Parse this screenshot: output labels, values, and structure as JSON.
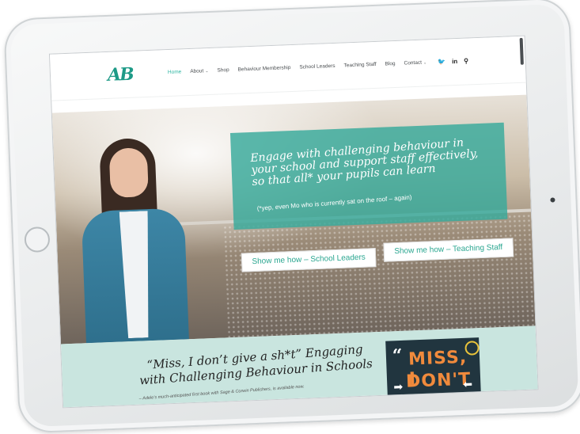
{
  "header": {
    "logo_text": "AB",
    "nav_items": [
      {
        "label": "Home",
        "active": true
      },
      {
        "label": "About",
        "has_dropdown": true
      },
      {
        "label": "Shop"
      },
      {
        "label": "Behaviour Membership"
      },
      {
        "label": "School Leaders"
      },
      {
        "label": "Teaching Staff"
      },
      {
        "label": "Blog"
      },
      {
        "label": "Contact",
        "has_dropdown": true
      }
    ],
    "social": {
      "twitter_icon": "twitter-icon",
      "linkedin_label": "in",
      "search_icon": "search-icon"
    }
  },
  "hero": {
    "headline": "Engage with challenging behaviour in your school and support staff effectively, so that all* your pupils can learn",
    "subline": "(*yep, even Mo who is currently sat on the roof – again)",
    "button_leaders": "Show me how – School Leaders",
    "button_staff": "Show me how – Teaching Staff"
  },
  "book": {
    "title": "“Miss, I don’t give a sh*t” Engaging with Challenging Behaviour in Schools",
    "caption": "– Adele’s much-anticipated first book with Sage & Corwin Publishers, is available now.",
    "cover": {
      "quote_mark": "“",
      "line1": "MISS, I",
      "line2": "DON'T",
      "arrow_left": "➡",
      "arrow_right": "⬅"
    }
  },
  "colors": {
    "accent": "#2bb5a1",
    "hero_box": "#37aa9b",
    "book_bg": "#c9e5df"
  }
}
